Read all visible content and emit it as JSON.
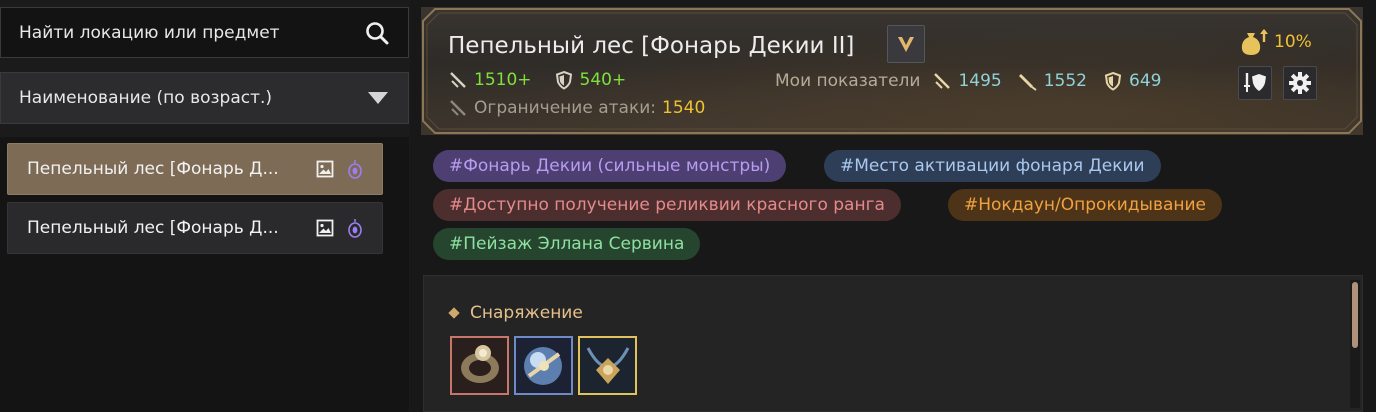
{
  "search": {
    "placeholder": "Найти локацию или предмет"
  },
  "sort": {
    "label": "Наименование (по возраст.)"
  },
  "list": [
    {
      "label": "Пепельный лес [Фонарь Д..."
    },
    {
      "label": "Пепельный лес [Фонарь Д..."
    }
  ],
  "header": {
    "title": "Пепельный лес [Фонарь Декии II]",
    "bonus": "10%",
    "attack_req": "1510+",
    "defense_req": "540+",
    "limit_label": "Ограничение атаки:",
    "limit_value": "1540",
    "my_label": "Мои показатели",
    "my_attack": "1495",
    "my_awakening": "1552",
    "my_defense": "649"
  },
  "tags": [
    {
      "label": "#Фонарь Декии (сильные монстры)",
      "bg": "#4d3f72",
      "color": "#b79cf0"
    },
    {
      "label": "#Место активации фонаря Декии",
      "bg": "#2f3e57",
      "color": "#a9c8f0"
    },
    {
      "label": "#Доступно получение реликвии красного ранга",
      "bg": "#4c2e2f",
      "color": "#e58a8a"
    },
    {
      "label": "#Нокдаун/Опрокидывание",
      "bg": "#4d3418",
      "color": "#f0a240"
    },
    {
      "label": "#Пейзаж Эллана Сервина",
      "bg": "#26452f",
      "color": "#8fe0a0"
    }
  ],
  "content": {
    "section_title": "Снаряжение",
    "items": [
      {
        "icon": "ring-item-icon",
        "border": "#c7766b"
      },
      {
        "icon": "orb-item-icon",
        "border": "#6f8ac8"
      },
      {
        "icon": "necklace-item-icon",
        "border": "#e2c25a"
      }
    ]
  },
  "colors": {
    "active_item": "#7d6b55",
    "accent_gold": "#f0c132",
    "stat_green": "#7ee03c",
    "stat_cyan": "#8fd2d8"
  }
}
